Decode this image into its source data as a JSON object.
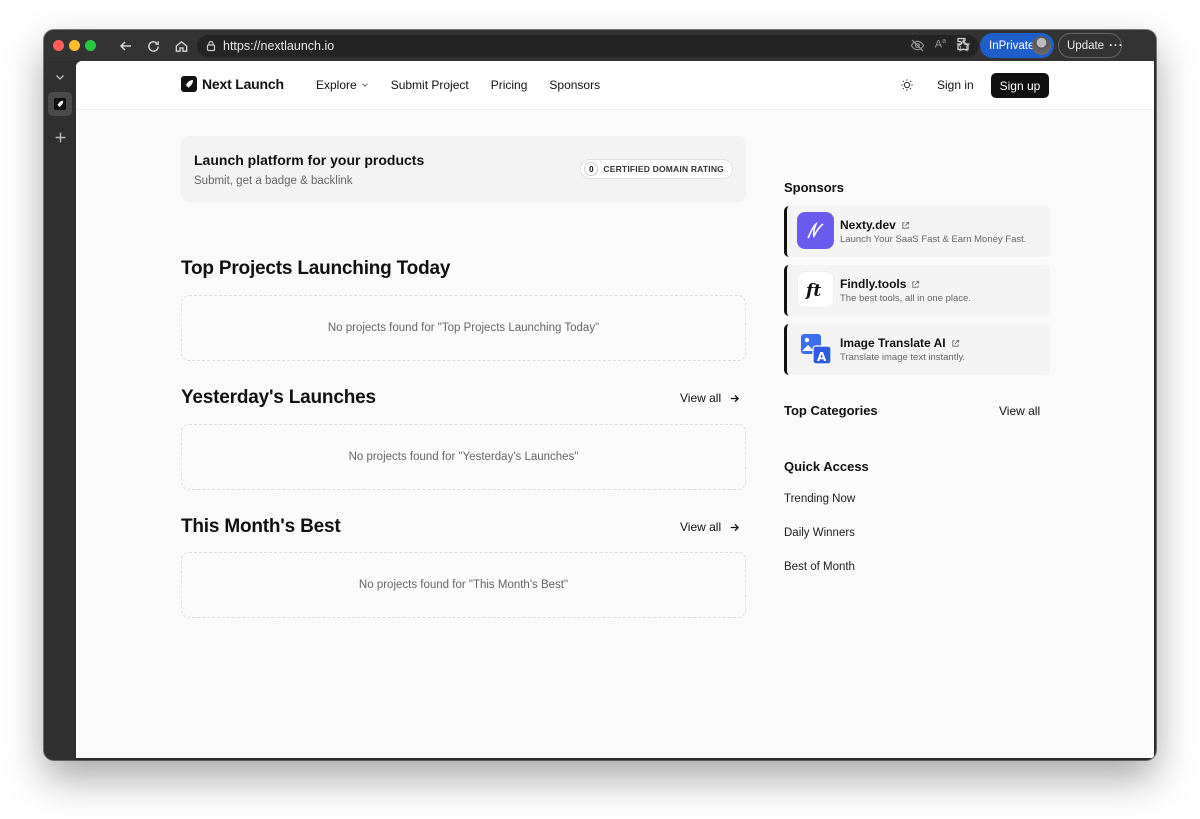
{
  "browser": {
    "url": "https://nextlaunch.io",
    "inprivate_label": "InPrivate",
    "update_label": "Update"
  },
  "site": {
    "logo_text": "Next Launch",
    "nav": [
      {
        "label": "Explore"
      },
      {
        "label": "Submit Project"
      },
      {
        "label": "Pricing"
      },
      {
        "label": "Sponsors"
      }
    ],
    "signin": "Sign in",
    "signup": "Sign up"
  },
  "hero": {
    "title": "Launch platform for your products",
    "subtitle": "Submit, get a badge & backlink",
    "rating_value": "0",
    "rating_label": "CERTIFIED DOMAIN RATING"
  },
  "sections": [
    {
      "title": "Top Projects Launching Today",
      "empty": "No projects found for \"Top Projects Launching Today\""
    },
    {
      "title": "Yesterday's Launches",
      "view_all": "View all",
      "empty": "No projects found for \"Yesterday's Launches\""
    },
    {
      "title": "This Month's Best",
      "view_all": "View all",
      "empty": "No projects found for \"This Month's Best\""
    }
  ],
  "sidebar": {
    "sponsors_title": "Sponsors",
    "sponsors": [
      {
        "name": "Nexty.dev",
        "desc": "Launch Your SaaS Fast & Earn Money Fast.",
        "icon": "nexty-logo",
        "color": "#6b5cf0"
      },
      {
        "name": "Findly.tools",
        "desc": "The best tools, all in one place.",
        "icon": "findly-logo",
        "color": "#ffffff"
      },
      {
        "name": "Image Translate AI",
        "desc": "Translate image text instantly.",
        "icon": "image-translate-logo",
        "color": "#3f6df0"
      }
    ],
    "categories_title": "Top Categories",
    "categories_view_all": "View all",
    "quick_access_title": "Quick Access",
    "quick_access": [
      {
        "label": "Trending Now"
      },
      {
        "label": "Daily Winners"
      },
      {
        "label": "Best of Month"
      }
    ]
  }
}
